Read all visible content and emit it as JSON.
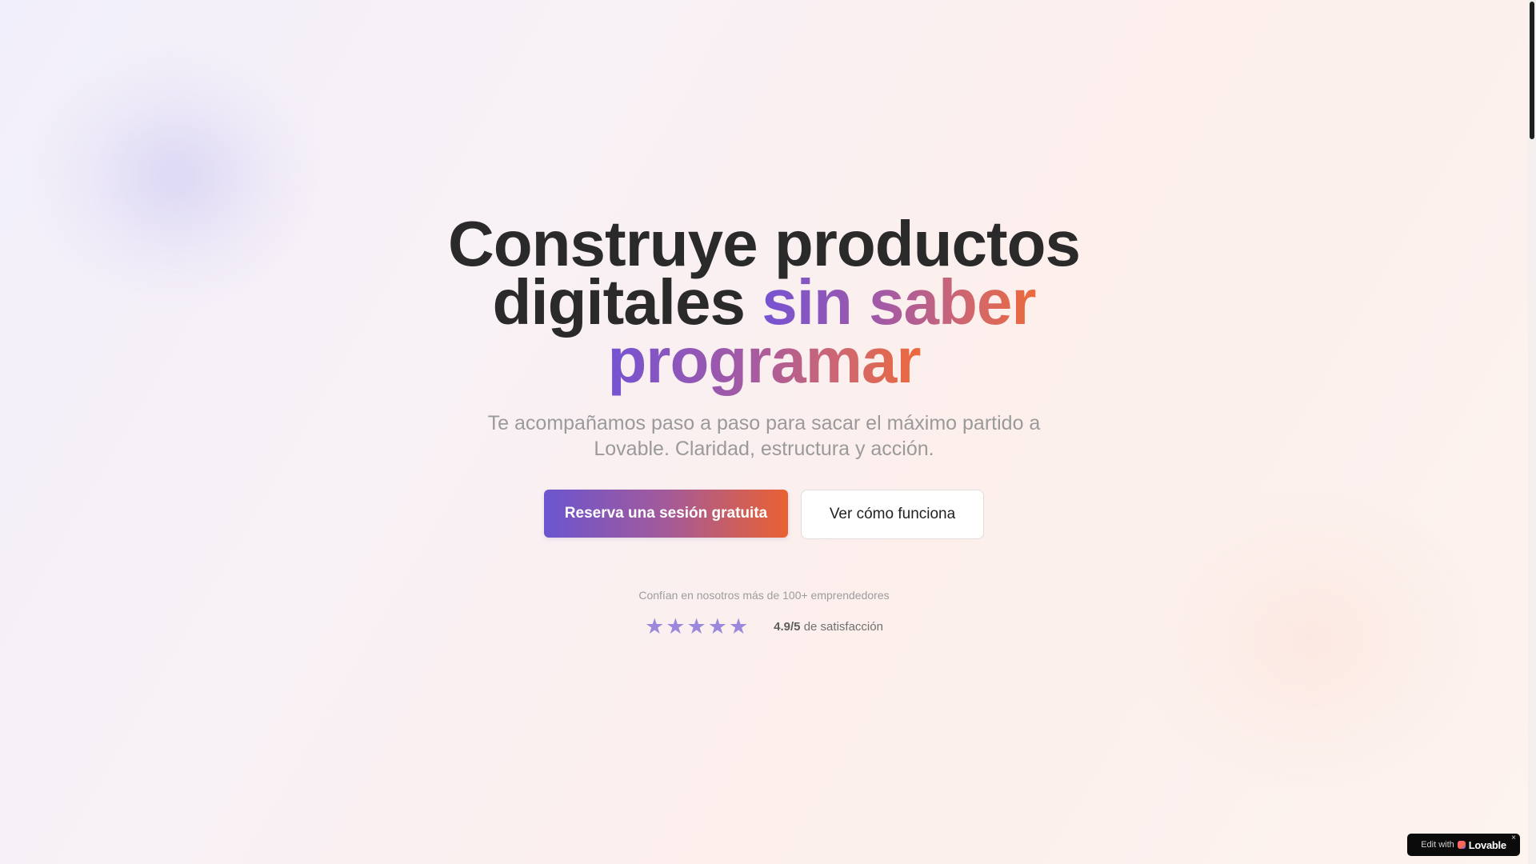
{
  "hero": {
    "title_line1": "Construye productos",
    "title_line2_plain": "digitales",
    "title_line2_highlight": "sin saber",
    "title_line3_highlight": "programar",
    "subtitle": "Te acompañamos paso a paso para sacar el máximo partido a Lovable. Claridad, estructura y acción."
  },
  "cta": {
    "primary_label": "Reserva una sesión gratuita",
    "secondary_label": "Ver cómo funciona"
  },
  "trust": {
    "text": "Confían en nosotros más de 100+ emprendedores"
  },
  "rating": {
    "stars": 5,
    "star_glyph": "★",
    "score": "4.9/5",
    "suffix": "de satisfacción"
  },
  "badge": {
    "edit_label": "Edit with",
    "brand": "Lovable",
    "close_glyph": "×"
  },
  "colors": {
    "accent_start": "#7553d3",
    "accent_end": "#ec6a3c",
    "star": "#9b88dc",
    "heading": "#2a2a2a"
  }
}
